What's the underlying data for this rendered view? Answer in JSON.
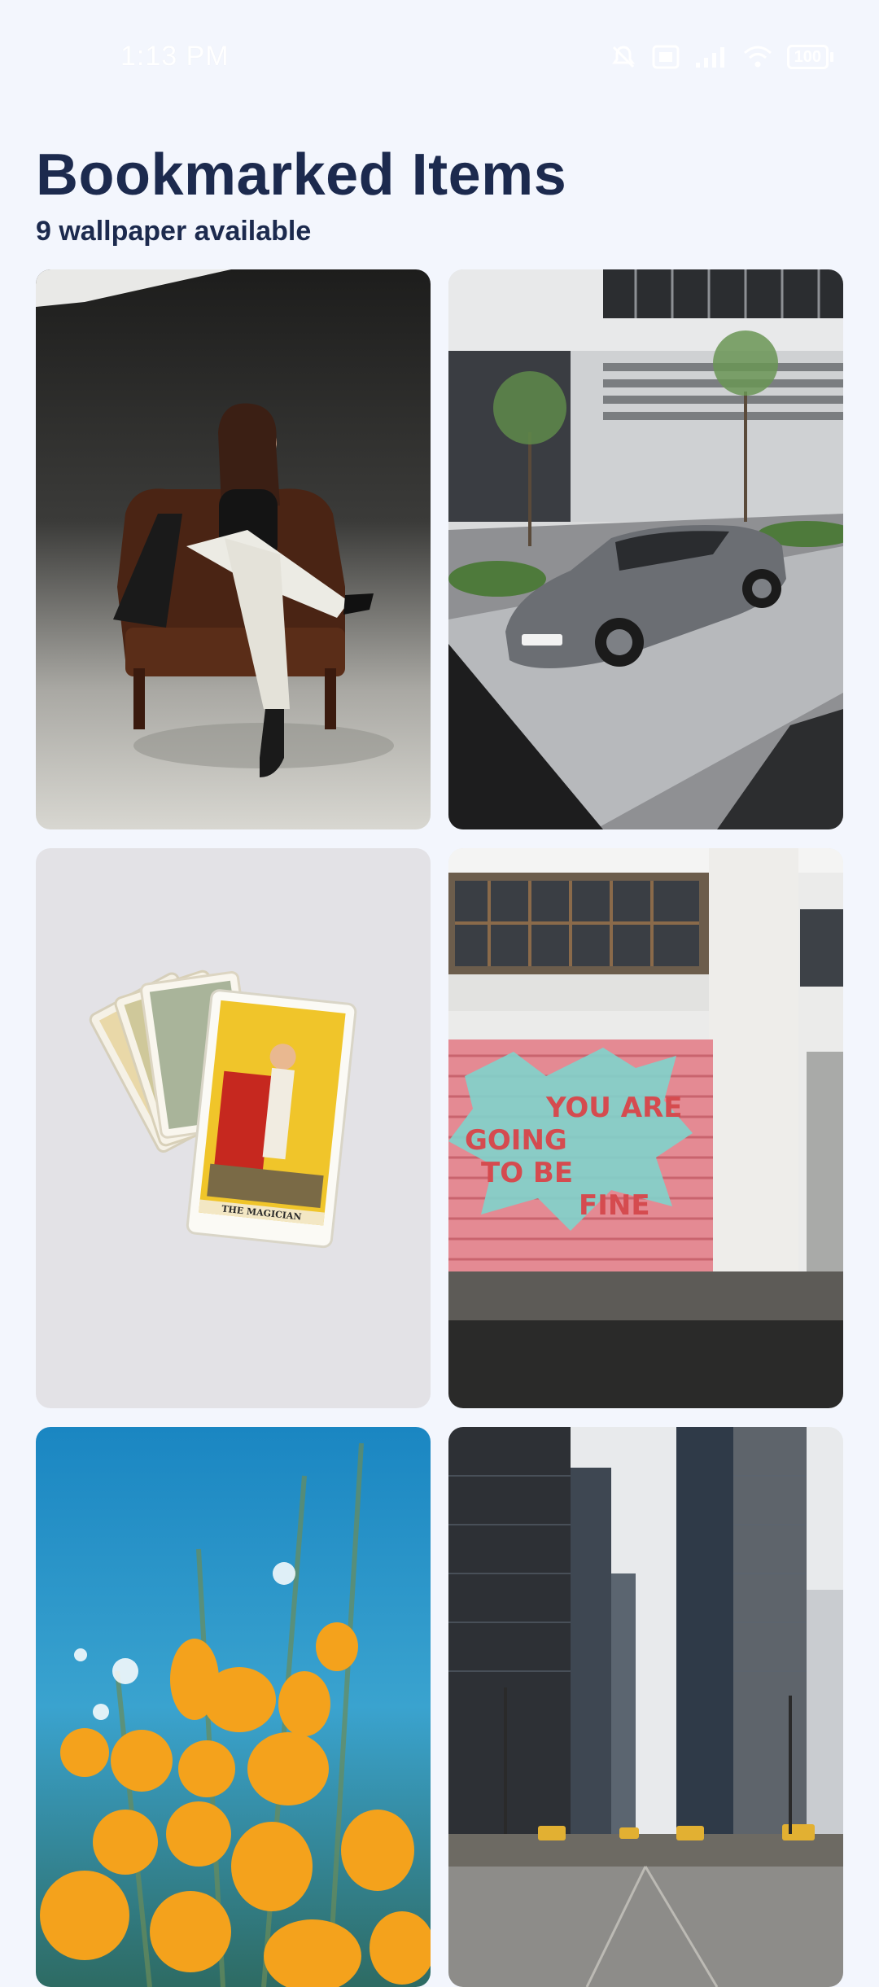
{
  "status_bar": {
    "time": "1:13 PM",
    "icons": [
      "bell-off-icon",
      "sim-card-icon",
      "signal-icon",
      "wifi-icon",
      "battery-icon"
    ],
    "battery_label": "100"
  },
  "header": {
    "title": "Bookmarked Items",
    "subtitle": "9 wallpaper available"
  },
  "wallpapers": [
    {
      "subject": "woman-in-leather-armchair"
    },
    {
      "subject": "grey-sports-car-by-office-building"
    },
    {
      "subject": "tarot-cards-the-magician"
    },
    {
      "subject": "graffiti-roller-door-building"
    },
    {
      "subject": "yellow-poppies-blue-sky"
    },
    {
      "subject": "city-street-skyscrapers"
    }
  ],
  "tarot_card_caption": "THE MAGICIAN",
  "graffiti_text": [
    "YOU ARE",
    "GOING",
    "TO BE",
    "FINE"
  ],
  "colors": {
    "background": "#f3f6fd",
    "title": "#1c2a4e",
    "status_text": "#ffffff"
  }
}
